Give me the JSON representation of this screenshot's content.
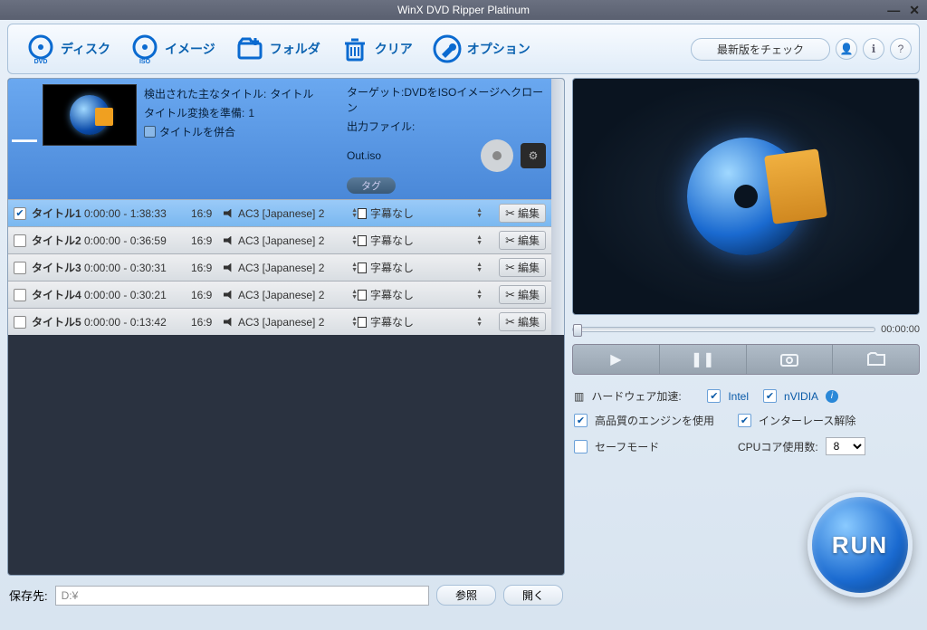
{
  "titlebar": {
    "title": "WinX DVD Ripper Platinum"
  },
  "toolbar": {
    "disc": "ディスク",
    "image": "イメージ",
    "folder": "フォルダ",
    "clear": "クリア",
    "option": "オプション",
    "check_update": "最新版をチェック"
  },
  "header": {
    "detected_label": "検出された主なタイトル:",
    "detected_value": "タイトル",
    "prepare_label": "タイトル変換を準備:",
    "prepare_value": "1",
    "merge_label": "タイトルを併合",
    "target_label": "ターゲット:",
    "target_value": "DVDをISOイメージへクローン",
    "outfile_label": "出力ファイル:",
    "outfile_value": "Out.iso",
    "tag": "タグ"
  },
  "titles": [
    {
      "checked": true,
      "name": "タイトル1",
      "time": "0:00:00 - 1:38:33",
      "ratio": "16:9",
      "audio": "AC3 [Japanese] 2",
      "subtitle": "字幕なし"
    },
    {
      "checked": false,
      "name": "タイトル2",
      "time": "0:00:00 - 0:36:59",
      "ratio": "16:9",
      "audio": "AC3 [Japanese] 2",
      "subtitle": "字幕なし"
    },
    {
      "checked": false,
      "name": "タイトル3",
      "time": "0:00:00 - 0:30:31",
      "ratio": "16:9",
      "audio": "AC3 [Japanese] 2",
      "subtitle": "字幕なし"
    },
    {
      "checked": false,
      "name": "タイトル4",
      "time": "0:00:00 - 0:30:21",
      "ratio": "16:9",
      "audio": "AC3 [Japanese] 2",
      "subtitle": "字幕なし"
    },
    {
      "checked": false,
      "name": "タイトル5",
      "time": "0:00:00 - 0:13:42",
      "ratio": "16:9",
      "audio": "AC3 [Japanese] 2",
      "subtitle": "字幕なし"
    }
  ],
  "edit_label": "編集",
  "bottom": {
    "save_label": "保存先:",
    "path": "D:¥",
    "browse": "参照",
    "open": "開く"
  },
  "player": {
    "time": "00:00:00"
  },
  "options": {
    "hw_label": "ハードウェア加速:",
    "intel": "Intel",
    "nvidia": "nVIDIA",
    "hq_engine": "高品質のエンジンを使用",
    "deinterlace": "インターレース解除",
    "safe_mode": "セーフモード",
    "cpu_label": "CPUコア使用数:",
    "cpu_value": "8"
  },
  "run": "RUN"
}
